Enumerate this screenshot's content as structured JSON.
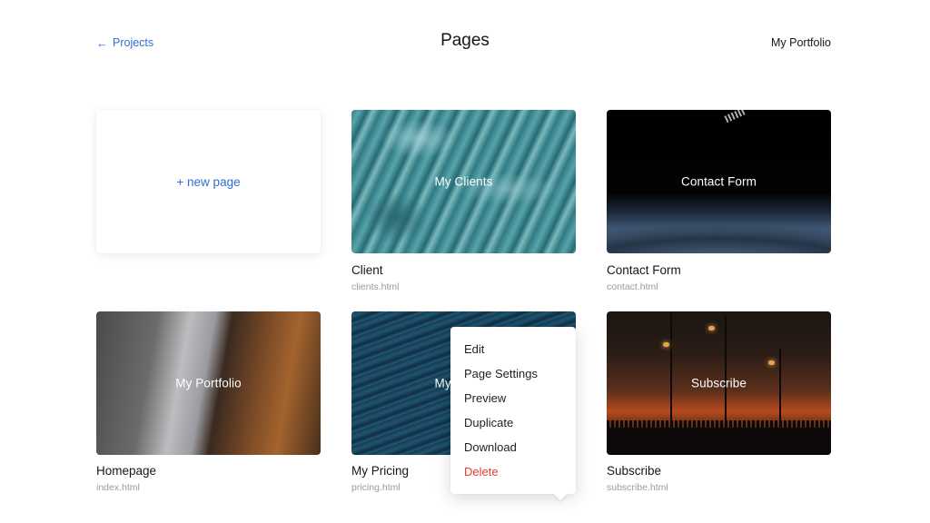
{
  "header": {
    "back_label": "Projects",
    "back_arrow": "←",
    "title": "Pages",
    "project_name": "My Portfolio"
  },
  "new_page_label": "+ new page",
  "pages": [
    {
      "overlay": "My Clients",
      "name": "Client",
      "file": "clients.html"
    },
    {
      "overlay": "Contact Form",
      "name": "Contact Form",
      "file": "contact.html"
    },
    {
      "overlay": "My Portfolio",
      "name": "Homepage",
      "file": "index.html"
    },
    {
      "overlay": "My Pricing",
      "name": "My Pricing",
      "file": "pricing.html"
    },
    {
      "overlay": "Subscribe",
      "name": "Subscribe",
      "file": "subscribe.html"
    }
  ],
  "context_menu": {
    "items": [
      "Edit",
      "Page Settings",
      "Preview",
      "Duplicate",
      "Download",
      "Delete"
    ],
    "danger_color": "#e53935"
  },
  "colors": {
    "accent": "#2f6fd0",
    "muted_text": "#9a9aa0"
  }
}
